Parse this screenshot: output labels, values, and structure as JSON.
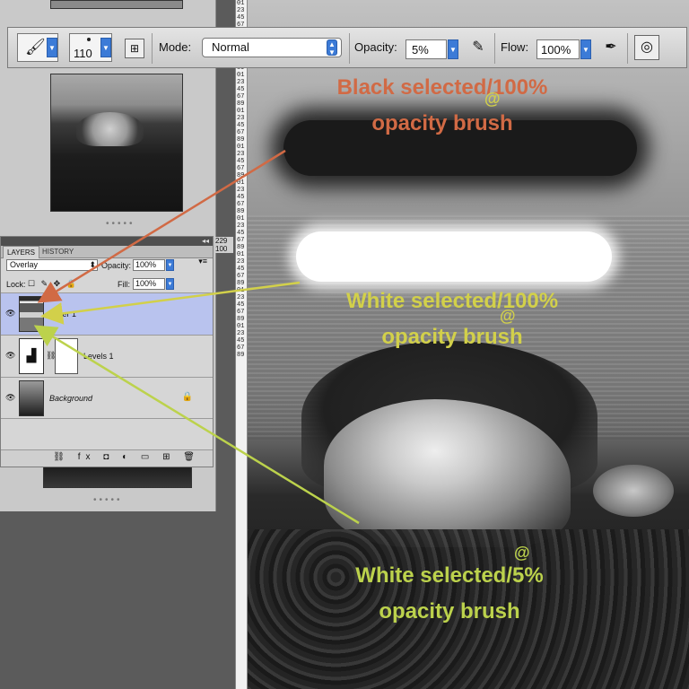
{
  "toolbar": {
    "brush_size": "110",
    "mode_label": "Mode:",
    "mode_value": "Normal",
    "opacity_label": "Opacity:",
    "opacity_value": "5%",
    "flow_label": "Flow:",
    "flow_value": "100%",
    "icons": [
      "brush-icon",
      "brush-preset-icon",
      "airbrush-icon",
      "tablet-pressure-icon",
      "tool-target-icon"
    ]
  },
  "layers_panel": {
    "tabs": [
      {
        "label": "LAYERS",
        "active": true
      },
      {
        "label": "HISTORY",
        "active": false
      }
    ],
    "blend_mode": "Overlay",
    "opacity_label": "Opacity:",
    "opacity_value": "100%",
    "lock_label": "Lock:",
    "fill_label": "Fill:",
    "fill_value": "100%",
    "layers": [
      {
        "name": "Layer 1",
        "selected": true
      },
      {
        "name": "Levels 1",
        "selected": false
      },
      {
        "name": "Background",
        "selected": false,
        "locked": true
      }
    ],
    "size_readout": [
      "229",
      "100"
    ]
  },
  "annotations": {
    "black_line1": "Black selected/100%",
    "black_line2": "opacity brush",
    "white100_line1": "White selected/100%",
    "white100_line2": "opacity brush",
    "white5_line1": "White selected/5%",
    "white5_line2": "opacity brush",
    "at_symbol": "@"
  },
  "colors": {
    "annotation_orange": "#d16a45",
    "annotation_yellow": "#d2d04a",
    "annotation_green": "#bcd24c",
    "selected_layer": "#b9c3ee",
    "dropdown_blue": "#3c7bd7"
  },
  "ruler": {
    "marks": "0123456789012345678901234567890123456789012345678901234567890123456789012345678901234567890123456789"
  }
}
